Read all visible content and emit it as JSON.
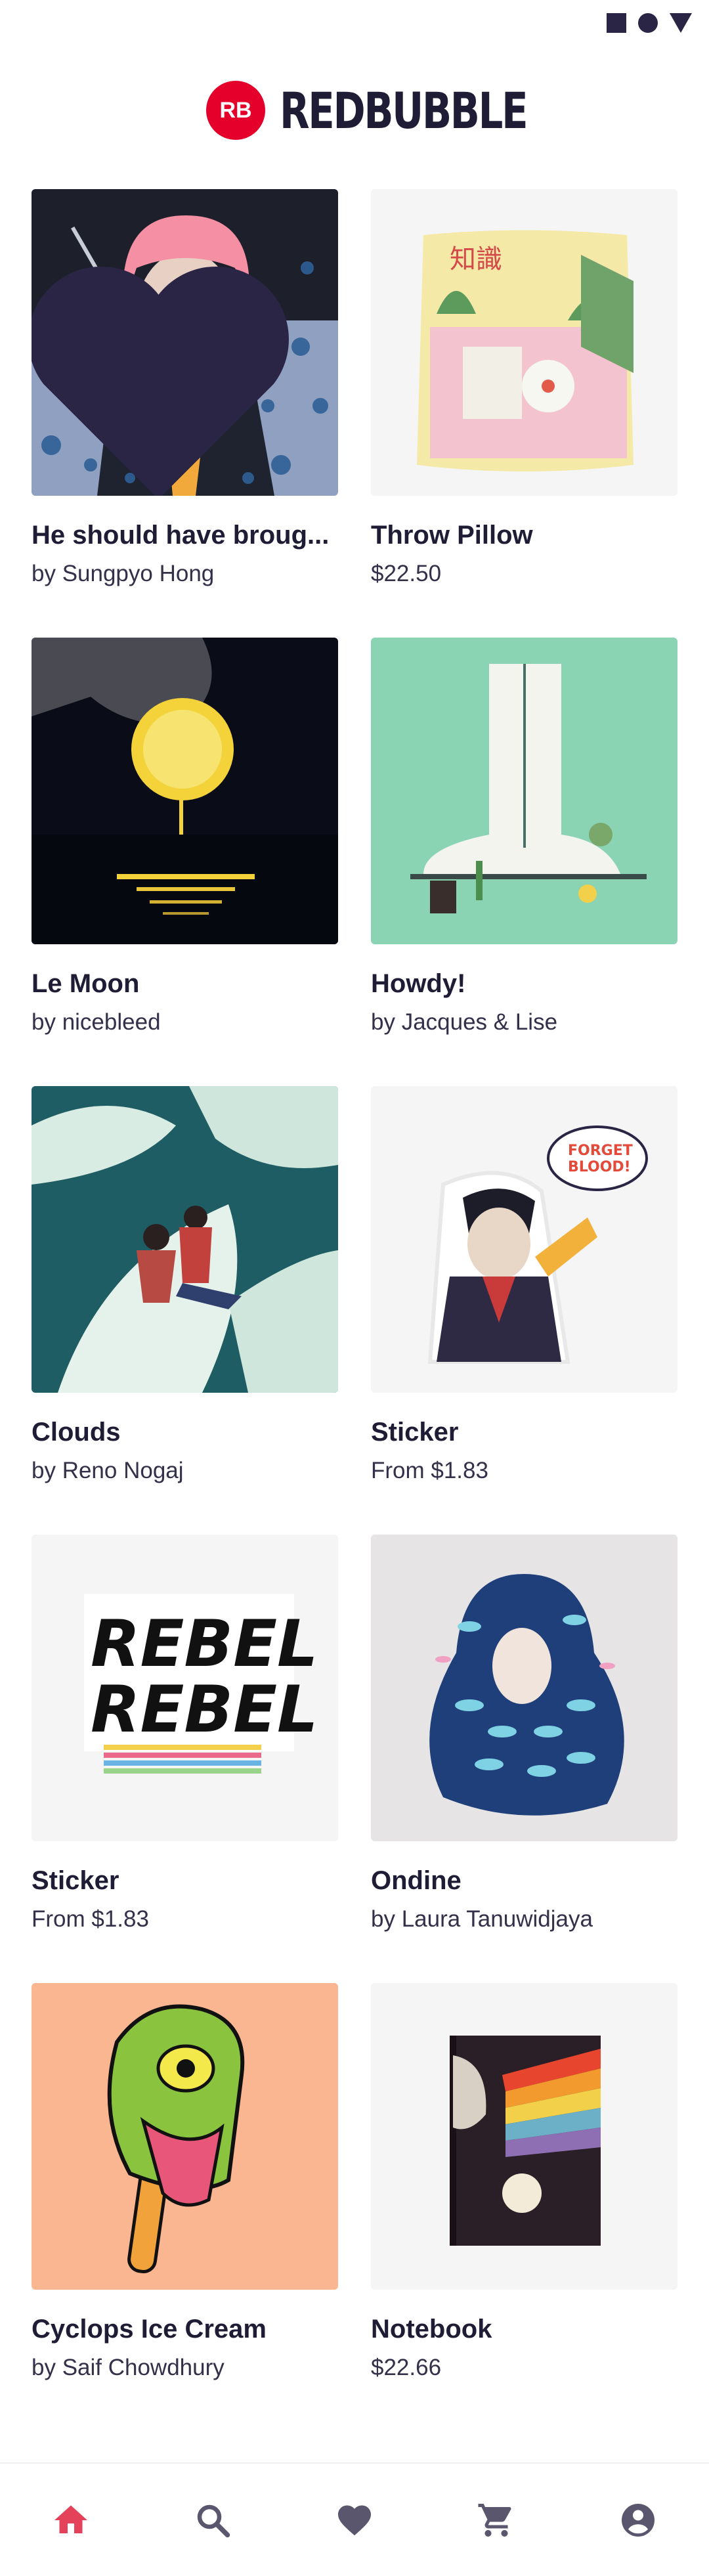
{
  "status_bar": {
    "icons": [
      "square-icon",
      "circle-icon",
      "triangle-icon"
    ]
  },
  "brand": {
    "logo_mark": "RB",
    "name": "REDBUBBLE",
    "color": "#e4002b"
  },
  "products": [
    {
      "title": "He should have broug...",
      "subtitle": "by Sungpyo Hong",
      "image": "pink-haired-woman-bubbles",
      "favorited": true
    },
    {
      "title": "Throw Pillow",
      "subtitle": "$22.50",
      "image": "pillow-cat-kitchen"
    },
    {
      "title": "Le Moon",
      "subtitle": "by nicebleed",
      "image": "lemon-moon-night"
    },
    {
      "title": "Howdy!",
      "subtitle": "by Jacques & Lise",
      "image": "giant-cowboy-boot"
    },
    {
      "title": "Clouds",
      "subtitle": "by Reno Nogaj",
      "image": "couple-on-clouds"
    },
    {
      "title": "Sticker",
      "subtitle": "From $1.83",
      "image": "vampire-pizza-sticker"
    },
    {
      "title": "Sticker",
      "subtitle": "From $1.83",
      "image": "rebel-rebel-sticker"
    },
    {
      "title": "Ondine",
      "subtitle": "by Laura Tanuwidjaya",
      "image": "woman-fish-hair"
    },
    {
      "title": "Cyclops Ice Cream",
      "subtitle": "by Saif Chowdhury",
      "image": "cyclops-popsicle"
    },
    {
      "title": "Notebook",
      "subtitle": "$22.66",
      "image": "skull-rainbow-notebook"
    }
  ],
  "bottom_nav": [
    {
      "icon": "home-icon",
      "active": true
    },
    {
      "icon": "search-icon",
      "active": false
    },
    {
      "icon": "heart-icon",
      "active": false
    },
    {
      "icon": "cart-icon",
      "active": false
    },
    {
      "icon": "account-icon",
      "active": false
    }
  ],
  "colors": {
    "nav_active": "#e4415b",
    "nav_inactive": "#5a566e",
    "text": "#1f1d36"
  }
}
